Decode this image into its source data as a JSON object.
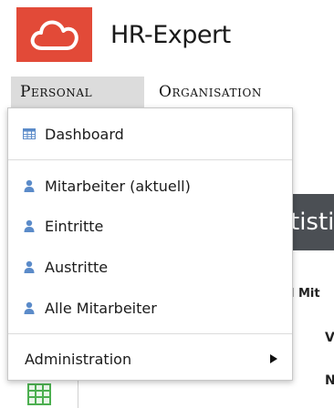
{
  "header": {
    "app_title": "HR-Expert",
    "logo_icon": "cloud-icon",
    "logo_color": "#e24a38"
  },
  "menubar": {
    "tabs": [
      {
        "label": "Personal",
        "active": true
      },
      {
        "label": "Organisation",
        "active": false
      }
    ],
    "active_tab_bg": "#dcdcdc"
  },
  "dropdown": {
    "items": [
      {
        "label": "Dashboard",
        "icon": "table-icon"
      },
      {
        "label": "Mitarbeiter (aktuell)",
        "icon": "person-icon"
      },
      {
        "label": "Eintritte",
        "icon": "person-icon"
      },
      {
        "label": "Austritte",
        "icon": "person-icon"
      },
      {
        "label": "Alle Mitarbeiter",
        "icon": "person-icon"
      },
      {
        "label": "Administration",
        "icon": "arrow-right-icon"
      }
    ],
    "icon_color": "#5b8bc9"
  },
  "background": {
    "dark_bar_text": "tisti",
    "text_mit": "l Mit",
    "text_w": "V",
    "text_n": "N",
    "grid_icon": "grid-icon",
    "grid_icon_color": "#4caf50"
  }
}
